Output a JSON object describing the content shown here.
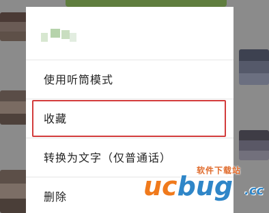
{
  "menu": {
    "items": [
      {
        "label": "使用听筒模式"
      },
      {
        "label": "收藏"
      },
      {
        "label": "转换为文字（仅普通话）"
      },
      {
        "label": "删除"
      }
    ],
    "highlighted_item": "收藏"
  },
  "watermark": {
    "top_text": "软件下载站",
    "brand_u": "uc",
    "brand_b": "bug",
    "brand_cc": ".cc"
  },
  "colors": {
    "overlay": "#8b8b8b",
    "menu_bg": "#ffffff",
    "highlight_border": "#d23a3a",
    "text": "#222222",
    "bubble_green": "#5f7d3e"
  }
}
